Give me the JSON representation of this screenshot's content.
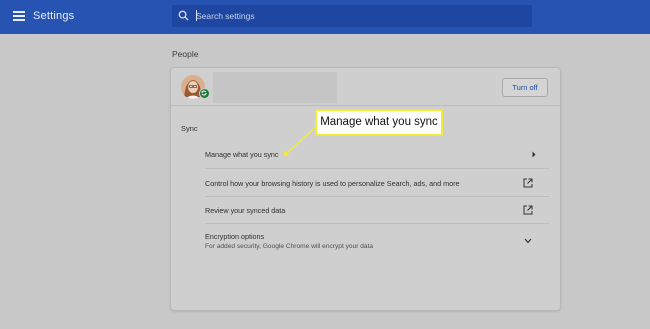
{
  "app": {
    "title": "Settings",
    "icons": {
      "menu": "hamburger-menu-icon",
      "search": "search-icon"
    }
  },
  "search": {
    "placeholder": "Search settings",
    "value": ""
  },
  "people": {
    "section_title": "People",
    "profile": {
      "avatar": "user-avatar",
      "badge_icon": "sync-badge-icon",
      "turn_off_label": "Turn off"
    },
    "sync": {
      "label": "Sync",
      "items": [
        {
          "label": "Manage what you sync",
          "sublabel": "",
          "icon": "chevron-right-icon"
        },
        {
          "label": "Control how your browsing history is used to personalize Search, ads, and more",
          "sublabel": "",
          "icon": "external-link-icon"
        },
        {
          "label": "Review your synced data",
          "sublabel": "",
          "icon": "external-link-icon"
        },
        {
          "label": "Encryption options",
          "sublabel": "For added security, Google Chrome will encrypt your data",
          "icon": "chevron-down-icon"
        }
      ]
    }
  },
  "callout": {
    "text": "Manage what you sync",
    "color": "#f2ea3b"
  },
  "colors": {
    "topbar": "#2754b3",
    "background": "#c8c8c8",
    "accent": "#1d4fa8"
  }
}
